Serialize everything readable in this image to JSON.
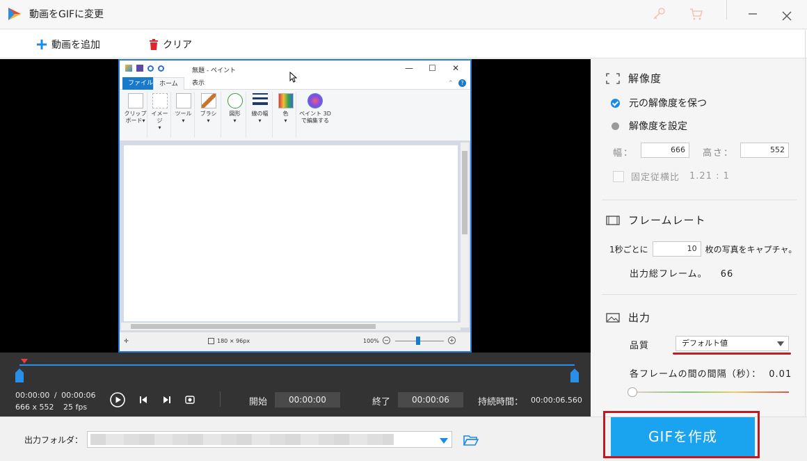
{
  "window": {
    "title": "動画をGIFに変更",
    "icons": [
      "key-icon",
      "cart-icon",
      "minimize-icon",
      "close-icon"
    ]
  },
  "toolbar": {
    "add_video": "動画を追加",
    "clear": "クリア"
  },
  "preview": {
    "paint": {
      "doc_title": "無題 - ペイント",
      "tabs": [
        "ファイル",
        "ホーム",
        "表示"
      ],
      "ribbon": [
        {
          "label1": "クリップ",
          "label2": "ボード▾"
        },
        {
          "label1": "イメージ",
          "label2": "▾"
        },
        {
          "label1": "ツール",
          "label2": "▾"
        },
        {
          "label1": "ブラシ",
          "label2": "▾"
        },
        {
          "label1": "図形",
          "label2": "▾"
        },
        {
          "label1": "線の幅",
          "label2": "▾"
        },
        {
          "label1": "色",
          "label2": "▾"
        },
        {
          "label1": "ペイント 3D",
          "label2": "で編集する"
        }
      ],
      "status_size": "180 × 96px",
      "zoom": "100%"
    }
  },
  "timeline": {
    "time_current": "00:00:00",
    "time_sep": "/",
    "time_total": "00:00:06",
    "dimensions": "666 x 552",
    "fps": "25 fps",
    "start_label": "開始",
    "start_value": "00:00:00",
    "end_label": "終了",
    "end_value": "00:00:06",
    "duration_label": "持続時間：",
    "duration_value": "00:00:06.560"
  },
  "resolution": {
    "title": "解像度",
    "keep_original": "元の解像度を保つ",
    "set_resolution": "解像度を設定",
    "width_label": "幅：",
    "width_value": "666",
    "height_label": "高さ：",
    "height_value": "552",
    "fixed_ratio_label": "固定従横比",
    "ratio_value": "1.21 : 1"
  },
  "framerate": {
    "title": "フレームレート",
    "per_second_prefix": "1秒ごとに",
    "per_second_value": "10",
    "per_second_suffix": "枚の写真をキャプチャ。",
    "total_frames_label": "出力総フレーム。",
    "total_frames_value": "66"
  },
  "output": {
    "title": "出力",
    "quality_label": "品質",
    "quality_value": "デフォルト値",
    "interval_label": "各フレームの間の間隔（秒）：",
    "interval_value": "0.01"
  },
  "bottom": {
    "output_folder_label": "出力フォルダ：",
    "create_gif": "GIFを作成"
  },
  "colors": {
    "accent": "#1aa3ee",
    "highlight": "#c8161d",
    "timeline_bg": "#333333"
  }
}
